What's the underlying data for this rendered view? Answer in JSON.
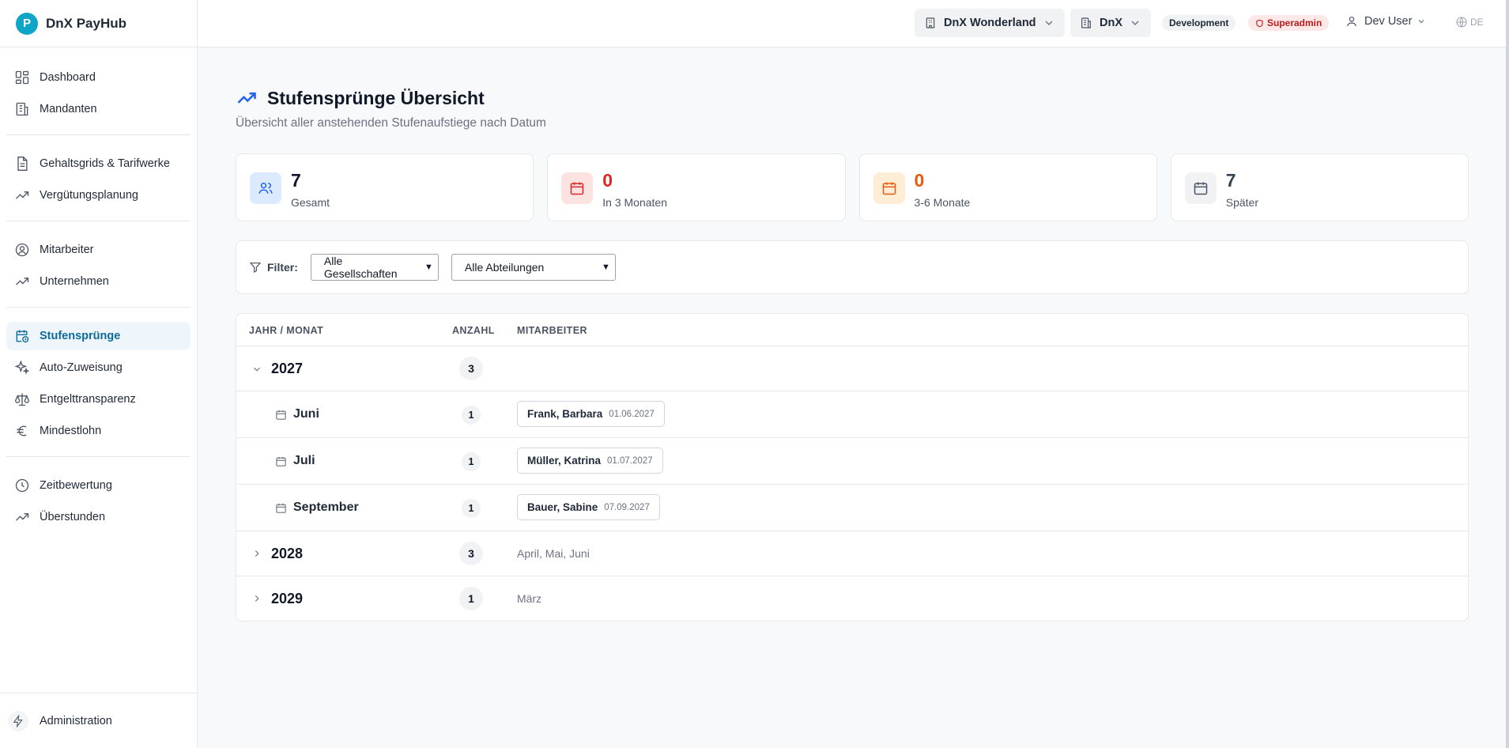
{
  "app": {
    "logo_letter": "P",
    "name": "DnX PayHub"
  },
  "sidebar": {
    "groups": [
      [
        {
          "label": "Dashboard",
          "icon": "dashboard-icon"
        },
        {
          "label": "Mandanten",
          "icon": "building-icon"
        }
      ],
      [
        {
          "label": "Gehaltsgrids & Tarifwerke",
          "icon": "document-icon"
        },
        {
          "label": "Vergütungsplanung",
          "icon": "trending-up-icon"
        }
      ],
      [
        {
          "label": "Mitarbeiter",
          "icon": "user-circle-icon"
        },
        {
          "label": "Unternehmen",
          "icon": "trending-up-icon"
        }
      ],
      [
        {
          "label": "Stufensprünge",
          "icon": "calendar-clock-icon",
          "active": true
        },
        {
          "label": "Auto-Zuweisung",
          "icon": "sparkles-icon"
        },
        {
          "label": "Entgelttransparenz",
          "icon": "scale-icon"
        },
        {
          "label": "Mindestlohn",
          "icon": "euro-icon"
        }
      ],
      [
        {
          "label": "Zeitbewertung",
          "icon": "clock-icon"
        },
        {
          "label": "Überstunden",
          "icon": "trending-up-icon"
        }
      ]
    ],
    "bottom": {
      "label": "Administration",
      "icon": "lightning-icon"
    }
  },
  "topbar": {
    "org_select": "DnX Wonderland",
    "company_select": "DnX",
    "env_badge": "Development",
    "role_badge": "Superadmin",
    "user": "Dev User",
    "lang": "DE"
  },
  "page": {
    "title": "Stufensprünge Übersicht",
    "subtitle": "Übersicht aller anstehenden Stufenaufstiege nach Datum"
  },
  "stats": [
    {
      "value": "7",
      "label": "Gesamt",
      "icon": "users-icon",
      "color": "#111827",
      "icon_bg": "#dbeafe",
      "icon_color": "#2563eb"
    },
    {
      "value": "0",
      "label": "In 3 Monaten",
      "icon": "calendar-icon",
      "color": "#dc2626",
      "icon_bg": "#fde2e2",
      "icon_color": "#dc2626"
    },
    {
      "value": "0",
      "label": "3-6 Monate",
      "icon": "calendar-icon",
      "color": "#ea580c",
      "icon_bg": "#ffedd5",
      "icon_color": "#ea580c"
    },
    {
      "value": "7",
      "label": "Später",
      "icon": "calendar-icon",
      "color": "#374151",
      "icon_bg": "#f1f2f4",
      "icon_color": "#4b5563"
    }
  ],
  "filter": {
    "label": "Filter:",
    "company": "Alle Gesellschaften",
    "department": "Alle Abteilungen"
  },
  "table": {
    "headers": {
      "period": "JAHR / MONAT",
      "count": "ANZAHL",
      "employees": "MITARBEITER"
    },
    "years": [
      {
        "year": "2027",
        "count": "3",
        "expanded": true,
        "months": [
          {
            "month": "Juni",
            "count": "1",
            "employee": "Frank, Barbara",
            "date": "01.06.2027"
          },
          {
            "month": "Juli",
            "count": "1",
            "employee": "Müller, Katrina",
            "date": "01.07.2027"
          },
          {
            "month": "September",
            "count": "1",
            "employee": "Bauer, Sabine",
            "date": "07.09.2027"
          }
        ]
      },
      {
        "year": "2028",
        "count": "3",
        "expanded": false,
        "summary": "April, Mai, Juni"
      },
      {
        "year": "2029",
        "count": "1",
        "expanded": false,
        "summary": "März"
      }
    ]
  }
}
